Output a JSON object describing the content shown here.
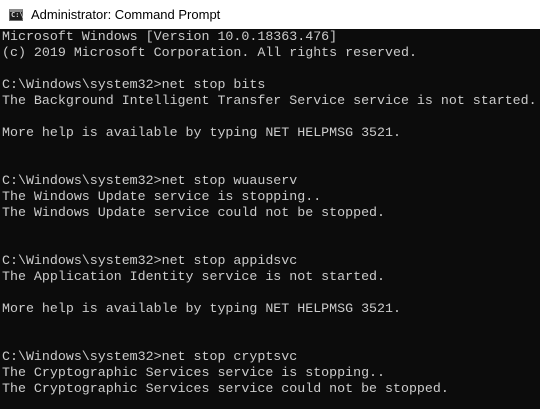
{
  "window": {
    "title": "Administrator: Command Prompt",
    "icon": "cmd-icon",
    "colors": {
      "console_background": "#0c0c0c",
      "console_text": "#cccccc",
      "titlebar_background": "#ffffff"
    }
  },
  "console": {
    "lines": [
      "Microsoft Windows [Version 10.0.18363.476]",
      "(c) 2019 Microsoft Corporation. All rights reserved.",
      "",
      "C:\\Windows\\system32>net stop bits",
      "The Background Intelligent Transfer Service service is not started.",
      "",
      "More help is available by typing NET HELPMSG 3521.",
      "",
      "",
      "C:\\Windows\\system32>net stop wuauserv",
      "The Windows Update service is stopping..",
      "The Windows Update service could not be stopped.",
      "",
      "",
      "C:\\Windows\\system32>net stop appidsvc",
      "The Application Identity service is not started.",
      "",
      "More help is available by typing NET HELPMSG 3521.",
      "",
      "",
      "C:\\Windows\\system32>net stop cryptsvc",
      "The Cryptographic Services service is stopping..",
      "The Cryptographic Services service could not be stopped."
    ]
  }
}
